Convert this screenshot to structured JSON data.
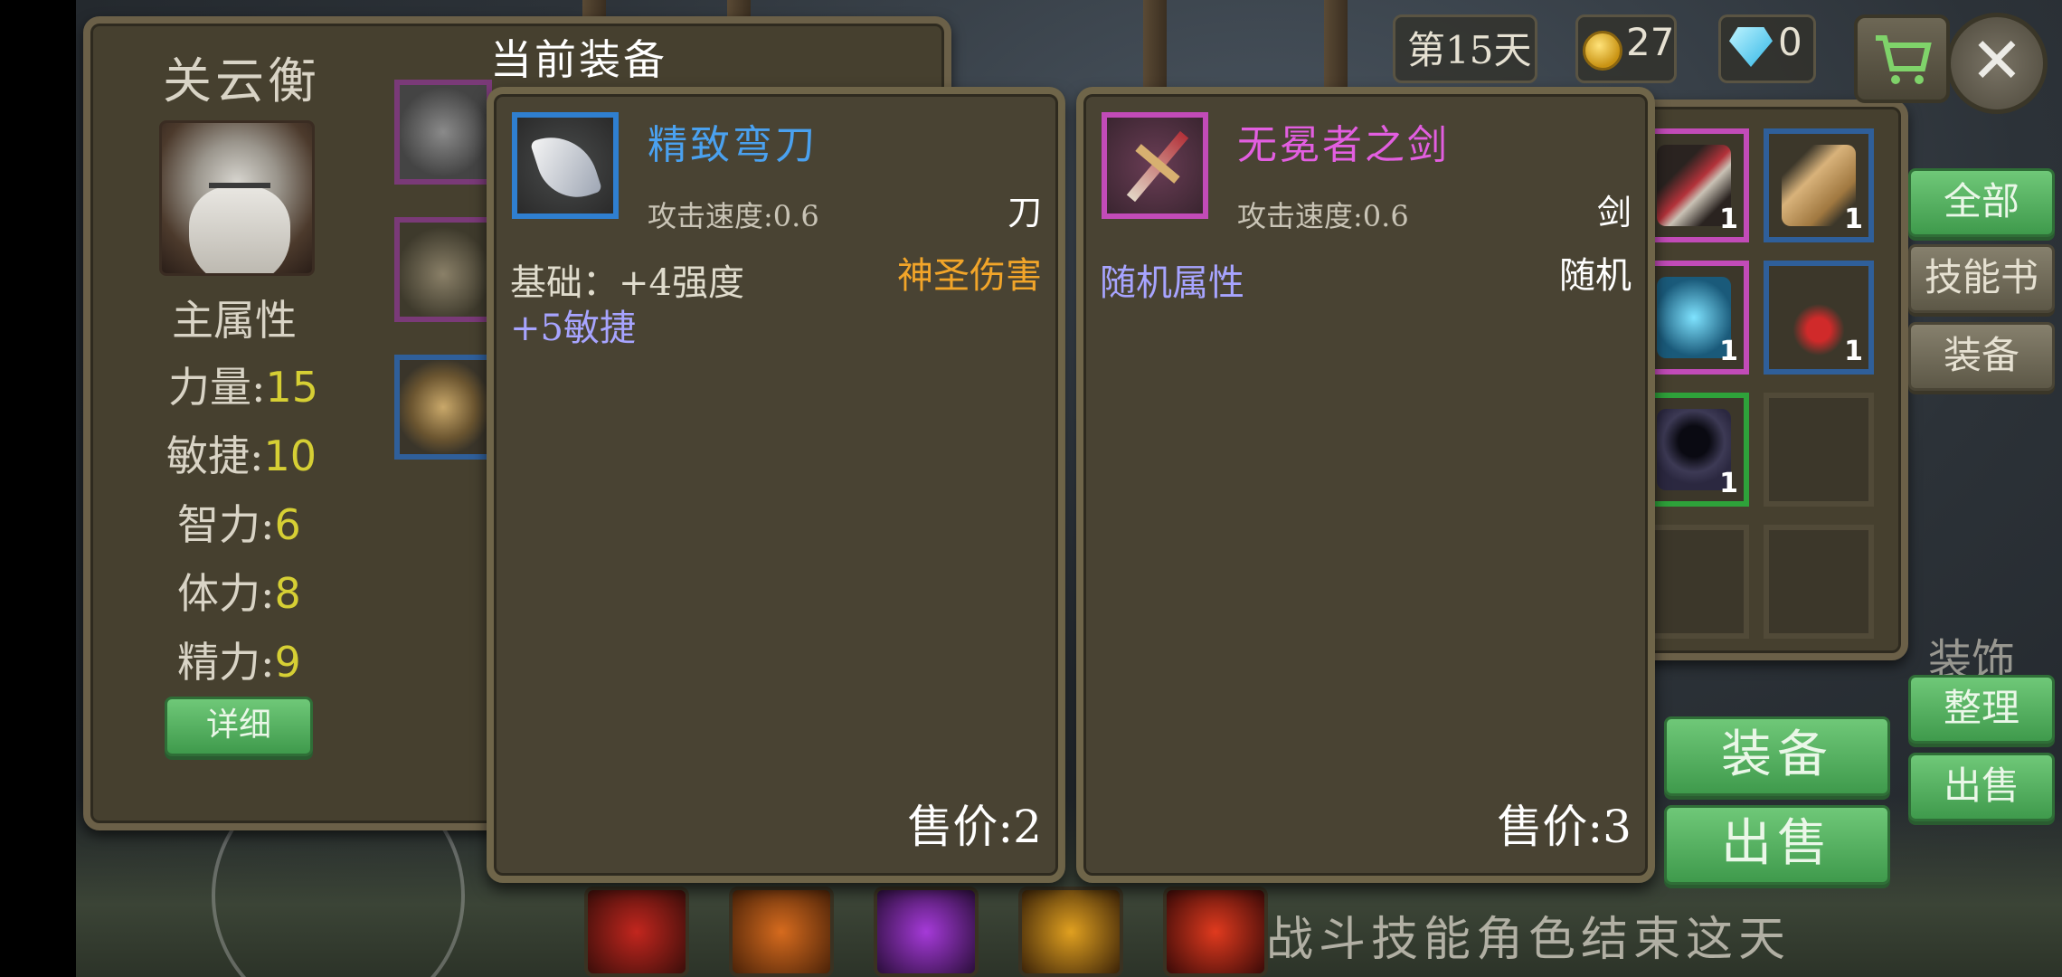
{
  "character": {
    "name": "关云衡",
    "attributes_title": "主属性",
    "stats": [
      {
        "label": "力量:",
        "value": "15"
      },
      {
        "label": "敏捷:",
        "value": "10"
      },
      {
        "label": "智力:",
        "value": "6"
      },
      {
        "label": "体力:",
        "value": "8"
      },
      {
        "label": "精力:",
        "value": "9"
      }
    ],
    "detail_button": "详细"
  },
  "current_equipment_title": "当前装备",
  "equipped_item": {
    "name": "精致弯刀",
    "attack_speed": "攻击速度:0.6",
    "type": "刀",
    "base": "基础：+4强度",
    "special": "神圣伤害",
    "bonus": "+5敏捷",
    "price": "售价:2"
  },
  "selected_item": {
    "name": "无冕者之剑",
    "attack_speed": "攻击速度:0.6",
    "type": "剑",
    "random_attr": "随机属性",
    "random_label": "随机",
    "price": "售价:3"
  },
  "inventory": {
    "counts": [
      "1",
      "1",
      "1",
      "1",
      "1"
    ]
  },
  "filter_tabs": {
    "all": "全部",
    "skill_book": "技能书",
    "equipment": "装备"
  },
  "actions": {
    "equip": "装备",
    "sell": "出售",
    "sort": "整理",
    "sell_small": "出售"
  },
  "topbar": {
    "day": "第15天",
    "gold": "27",
    "gems": "0",
    "close": "✕"
  },
  "background": {
    "hint": "战斗技能角色结束这天",
    "deco_label": "装饰"
  },
  "colors": {
    "rarity_blue": "#4aa1ef",
    "rarity_pink": "#e25ee0",
    "stat_value": "#d6cf34",
    "holy_damage": "#f2a529",
    "bonus_stat": "#a7a4ff",
    "button_green": "#5cb868"
  }
}
